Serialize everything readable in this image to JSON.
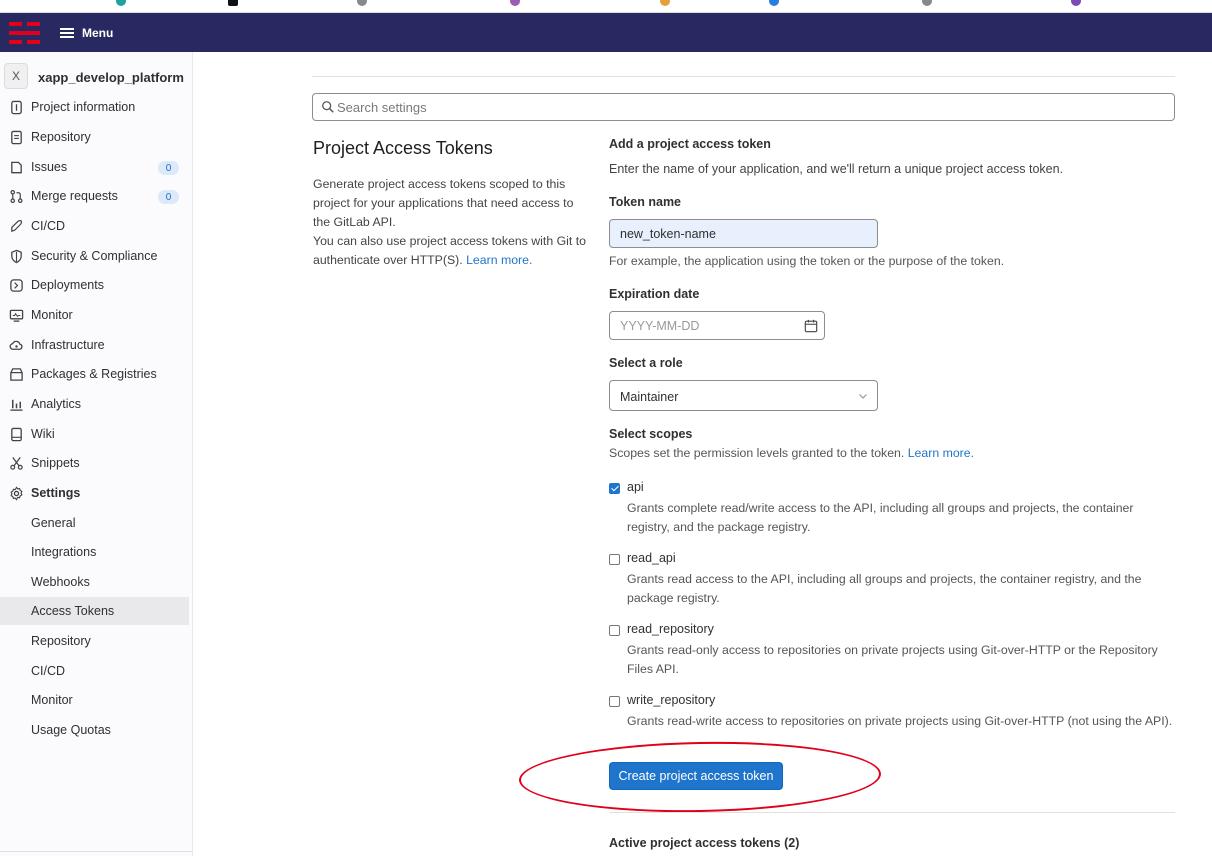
{
  "navbar": {
    "menu_label": "Menu"
  },
  "project": {
    "avatar_letter": "X",
    "name": "xapp_develop_platform"
  },
  "sidebar": {
    "items": [
      {
        "label": "Project information",
        "icon": "info-icon"
      },
      {
        "label": "Repository",
        "icon": "document-icon"
      },
      {
        "label": "Issues",
        "icon": "issues-icon",
        "count": "0"
      },
      {
        "label": "Merge requests",
        "icon": "merge-request-icon",
        "count": "0"
      },
      {
        "label": "CI/CD",
        "icon": "rocket-icon"
      },
      {
        "label": "Security & Compliance",
        "icon": "shield-icon"
      },
      {
        "label": "Deployments",
        "icon": "deployments-icon"
      },
      {
        "label": "Monitor",
        "icon": "monitor-icon"
      },
      {
        "label": "Infrastructure",
        "icon": "cloud-icon"
      },
      {
        "label": "Packages & Registries",
        "icon": "package-icon"
      },
      {
        "label": "Analytics",
        "icon": "chart-icon"
      },
      {
        "label": "Wiki",
        "icon": "book-icon"
      },
      {
        "label": "Snippets",
        "icon": "scissors-icon"
      },
      {
        "label": "Settings",
        "icon": "gear-icon"
      }
    ],
    "settings_sub": [
      "General",
      "Integrations",
      "Webhooks",
      "Access Tokens",
      "Repository",
      "CI/CD",
      "Monitor",
      "Usage Quotas"
    ],
    "active_item": "Access Tokens"
  },
  "search": {
    "placeholder": "Search settings"
  },
  "section": {
    "title": "Project Access Tokens",
    "description_1": "Generate project access tokens scoped to this project for your applications that need access to the GitLab API.",
    "description_2": "You can also use project access tokens with Git to authenticate over HTTP(S).",
    "learn_more": "Learn more."
  },
  "form": {
    "heading": "Add a project access token",
    "intro": "Enter the name of your application, and we'll return a unique project access token.",
    "token_name_label": "Token name",
    "token_name_value": "new_token-name",
    "token_name_help": "For example, the application using the token or the purpose of the token.",
    "expiration_label": "Expiration date",
    "expiration_placeholder": "YYYY-MM-DD",
    "role_label": "Select a role",
    "role_value": "Maintainer",
    "scopes_label": "Select scopes",
    "scopes_help": "Scopes set the permission levels granted to the token.",
    "scopes_learn_more": "Learn more.",
    "scopes": [
      {
        "name": "api",
        "checked": true,
        "description": "Grants complete read/write access to the API, including all groups and projects, the container registry, and the package registry."
      },
      {
        "name": "read_api",
        "checked": false,
        "description": "Grants read access to the API, including all groups and projects, the container registry, and the package registry."
      },
      {
        "name": "read_repository",
        "checked": false,
        "description": "Grants read-only access to repositories on private projects using Git-over-HTTP or the Repository Files API."
      },
      {
        "name": "write_repository",
        "checked": false,
        "description": "Grants read-write access to repositories on private projects using Git-over-HTTP (not using the API)."
      }
    ],
    "submit_label": "Create project access token"
  },
  "active_tokens": {
    "label": "Active project access tokens (2)"
  },
  "colors": {
    "navbar": "#292961",
    "brand_red": "#e3001b",
    "primary": "#1f75cb",
    "highlight": "#e0001a"
  }
}
